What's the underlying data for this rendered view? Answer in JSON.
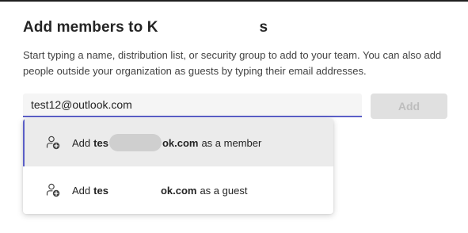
{
  "dialog": {
    "title_visible_start": "Add members to K",
    "title_visible_end": "s",
    "description": "Start typing a name, distribution list, or security group to add to your team. You can also add people outside your organization as guests by typing their email addresses."
  },
  "search": {
    "value": "test12@outlook.com"
  },
  "add_button": {
    "label": "Add"
  },
  "suggestions": [
    {
      "prefix": "Add",
      "email_start": "tes",
      "email_end": "ok.com",
      "suffix": "as a member",
      "icon": "person-add-icon",
      "selected": true
    },
    {
      "prefix": "Add",
      "email_start": "tes",
      "email_end": "ok.com",
      "suffix": "as a guest",
      "icon": "person-add-icon",
      "selected": false
    }
  ],
  "colors": {
    "accent": "#5b5fc7",
    "disabled_button_bg": "#e0e0e0",
    "disabled_button_text": "#bdbdbd"
  }
}
